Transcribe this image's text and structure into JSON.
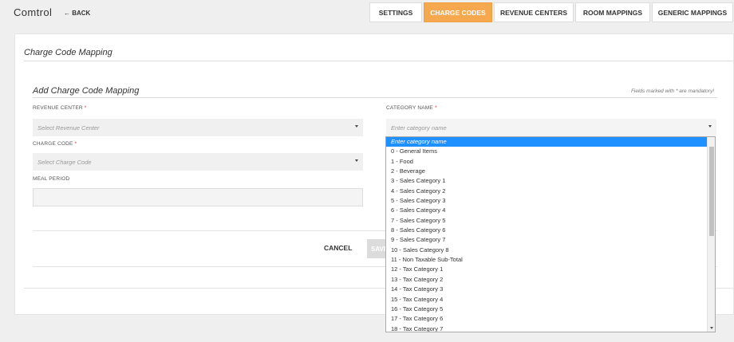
{
  "header": {
    "app_title": "Comtrol",
    "back_label": "← BACK",
    "tabs": [
      {
        "label": "SETTINGS",
        "active": false
      },
      {
        "label": "CHARGE CODES",
        "active": true
      },
      {
        "label": "REVENUE CENTERS",
        "active": false
      },
      {
        "label": "ROOM MAPPINGS",
        "active": false
      },
      {
        "label": "GENERIC MAPPINGS",
        "active": false
      }
    ]
  },
  "panel": {
    "title": "Charge Code Mapping",
    "form_title": "Add Charge Code Mapping",
    "mandatory_note": "Fields marked with * are mandatory!"
  },
  "form": {
    "revenue_center": {
      "label": "REVENUE CENTER",
      "required_mark": "*",
      "placeholder": "Select Revenue Center"
    },
    "charge_code": {
      "label": "CHARGE CODE",
      "required_mark": "*",
      "placeholder": "Select Charge Code"
    },
    "meal_period": {
      "label": "MEAL PERIOD",
      "value": ""
    },
    "category_name": {
      "label": "CATEGORY NAME",
      "required_mark": "*",
      "placeholder": "Enter category name"
    },
    "cancel_label": "CANCEL",
    "save_label": "SAVE"
  },
  "dropdown": {
    "highlighted_index": 0,
    "options": [
      "Enter category name",
      "0 - General Items",
      "1 - Food",
      "2 - Beverage",
      "3 - Sales Category 1",
      "4 - Sales Category 2",
      "5 - Sales Category 3",
      "6 - Sales Category 4",
      "7 - Sales Category 5",
      "8 - Sales Category 6",
      "9 - Sales Category 7",
      "10 - Sales Category 8",
      "11 - Non Taxable Sub-Total",
      "12 - Tax Category 1",
      "13 - Tax Category 2",
      "14 - Tax Category 3",
      "15 - Tax Category 4",
      "16 - Tax Category 5",
      "17 - Tax Category 6",
      "18 - Tax Category 7"
    ]
  },
  "colors": {
    "accent": "#f6a84e",
    "highlight": "#1e90ff"
  }
}
